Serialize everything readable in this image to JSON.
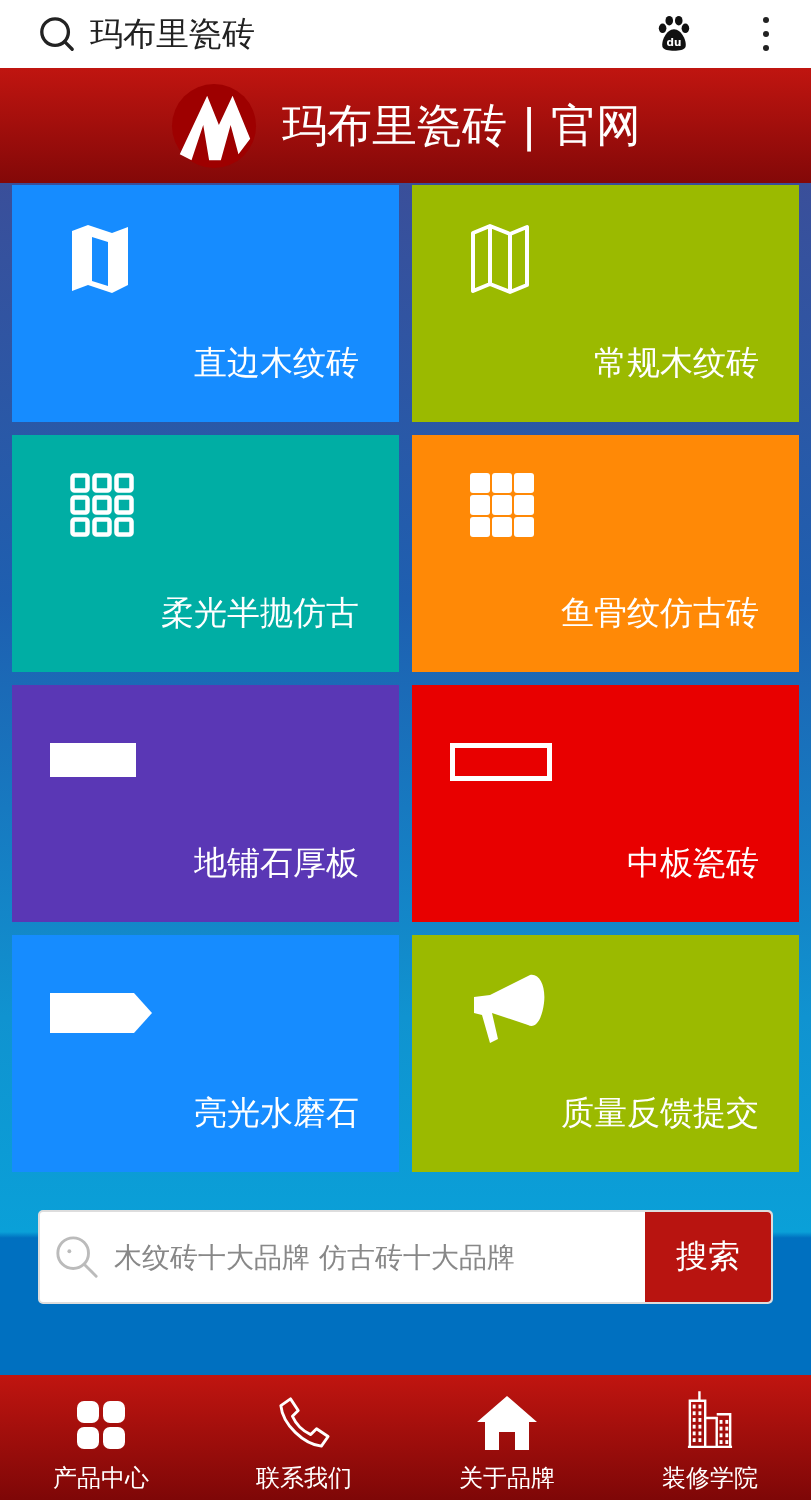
{
  "top_bar": {
    "query": "玛布里瓷砖",
    "paw_logo_text": "du"
  },
  "header": {
    "title": "玛布里瓷砖 | 官网"
  },
  "tiles": [
    {
      "label": "直边木纹砖",
      "color": "#168cff",
      "kind": "mapfilled"
    },
    {
      "label": "常规木纹砖",
      "color": "#9bba00",
      "kind": "mapoutline"
    },
    {
      "label": "柔光半抛仿古",
      "color": "#00aea4",
      "kind": "gridoutline"
    },
    {
      "label": "鱼骨纹仿古砖",
      "color": "#ff8906",
      "kind": "gridfilled"
    },
    {
      "label": "地铺石厚板",
      "color": "#5a37b5",
      "kind": "barfilled"
    },
    {
      "label": "中板瓷砖",
      "color": "#e80000",
      "kind": "baroutline"
    },
    {
      "label": "亮光水磨石",
      "color": "#168cff",
      "kind": "tag"
    },
    {
      "label": "质量反馈提交",
      "color": "#9bba00",
      "kind": "megaphone"
    }
  ],
  "search": {
    "placeholder": "木纹砖十大品牌 仿古砖十大品牌",
    "button": "搜索"
  },
  "bottom_nav": [
    {
      "label": "产品中心",
      "kind": "grid"
    },
    {
      "label": "联系我们",
      "kind": "phone"
    },
    {
      "label": "关于品牌",
      "kind": "house"
    },
    {
      "label": "装修学院",
      "kind": "building"
    }
  ]
}
